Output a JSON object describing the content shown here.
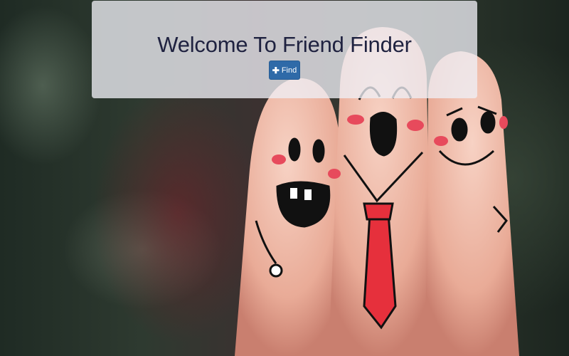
{
  "jumbotron": {
    "title": "Welcome To Friend Finder",
    "find_button": {
      "label": "Find",
      "icon": "plus-icon"
    }
  },
  "background": {
    "description_icon": "smiley-fingers-image"
  },
  "colors": {
    "button": "#2f6aa8",
    "title": "#1f2240",
    "panel": "rgba(238,238,245,0.78)"
  }
}
